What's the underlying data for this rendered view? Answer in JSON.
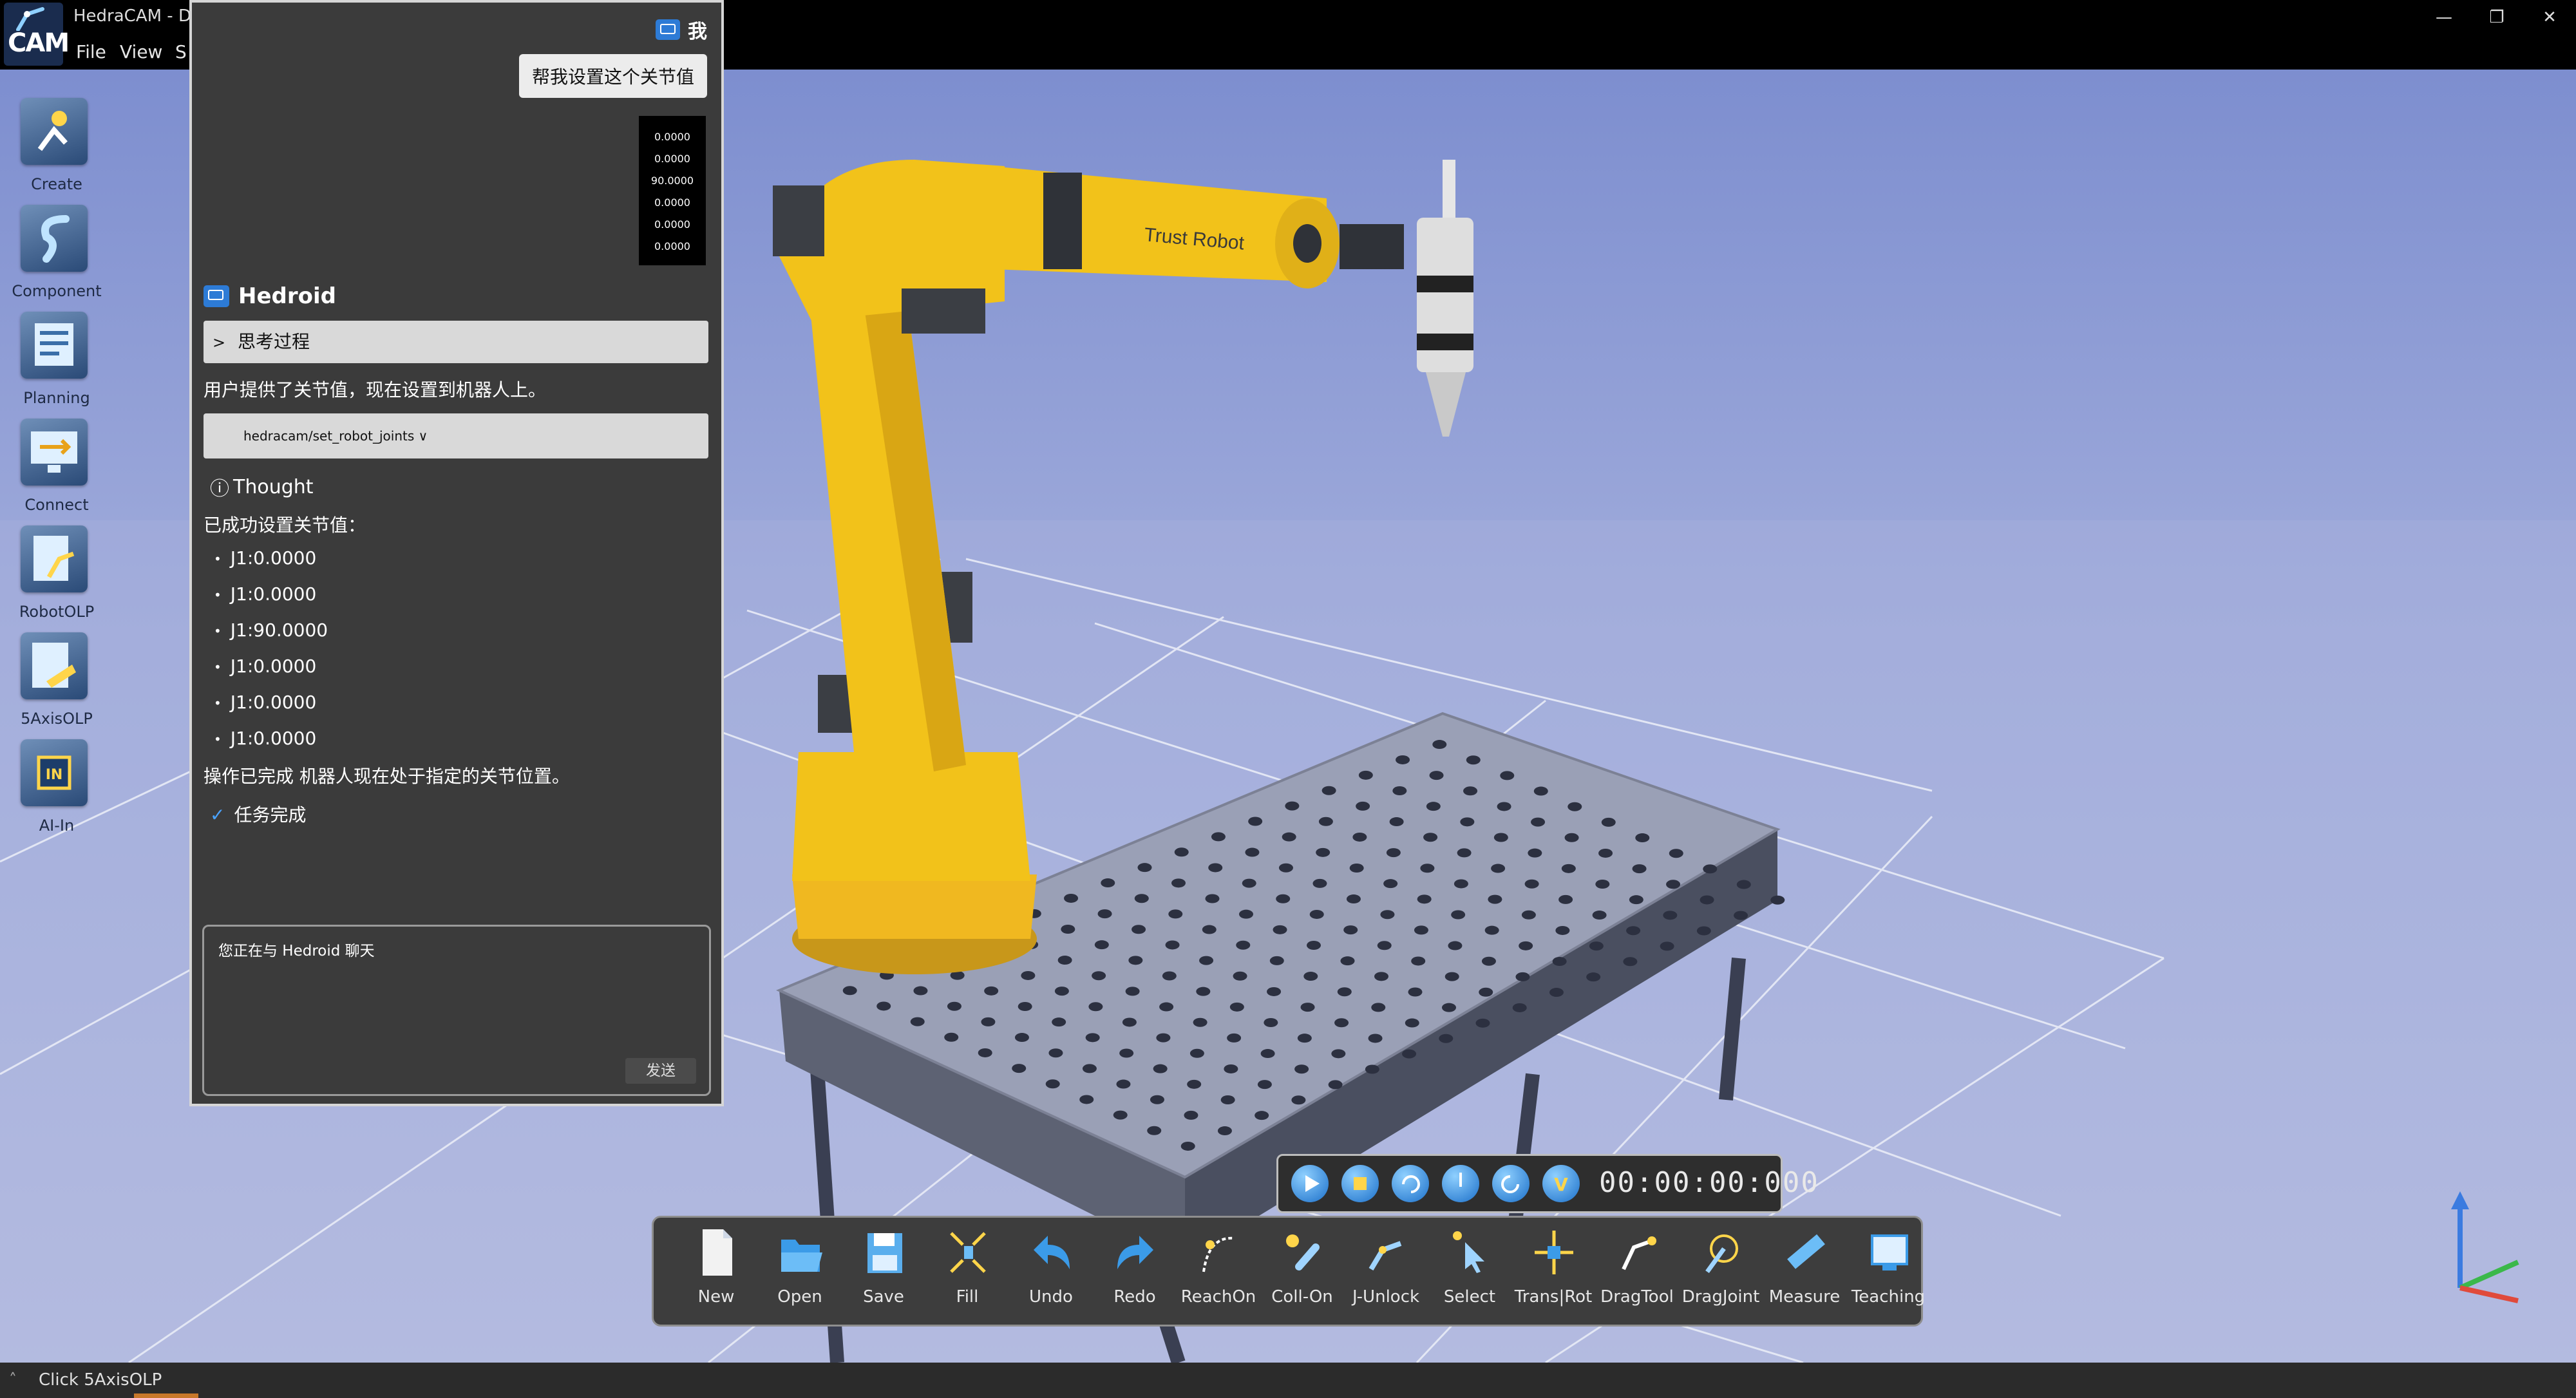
{
  "window": {
    "logo_text": "CAM",
    "title": "HedraCAM - D",
    "controls": [
      "—",
      "❐",
      "✕"
    ]
  },
  "menu": [
    "File",
    "View",
    "S"
  ],
  "left_toolbar": [
    {
      "label": "Create",
      "icon": "create-icon"
    },
    {
      "label": "Component",
      "icon": "component-icon"
    },
    {
      "label": "Planning",
      "icon": "planning-icon"
    },
    {
      "label": "Connect",
      "icon": "connect-icon"
    },
    {
      "label": "RobotOLP",
      "icon": "robot-olp-icon"
    },
    {
      "label": "5AxisOLP",
      "icon": "five-axis-olp-icon"
    },
    {
      "label": "AI-In",
      "icon": "ai-in-icon"
    }
  ],
  "chat": {
    "user_name": "我",
    "user_message": "帮我设置这个关节值",
    "joint_values": [
      "0.0000",
      "0.0000",
      "90.0000",
      "0.0000",
      "0.0000",
      "0.0000"
    ],
    "bot_name": "Hedroid",
    "thinking_label": "思考过程",
    "intro_text": "用户提供了关节值，现在设置到机器人上。",
    "tool_call": "hedracam/set_robot_joints ∨",
    "thought_label": "Thought",
    "success_text": "已成功设置关节值：",
    "joint_results": [
      "J1:0.0000",
      "J1:0.0000",
      "J1:90.0000",
      "J1:0.0000",
      "J1:0.0000",
      "J1:0.0000"
    ],
    "complete_text": "操作已完成 机器人现在处于指定的关节位置。",
    "task_done": "任务完成",
    "input_placeholder": "您正在与 Hedroid 聊天",
    "send_label": "发送"
  },
  "scene": {
    "robot_label": "Trust Robot"
  },
  "playback": {
    "time": "00:00:00:000",
    "buttons": [
      "play-icon",
      "stop-icon",
      "loop-icon",
      "speed-icon",
      "reverse-icon",
      "v-icon"
    ]
  },
  "bottom_toolbar": [
    "New",
    "Open",
    "Save",
    "Fill",
    "Undo",
    "Redo",
    "ReachOn",
    "Coll-On",
    "J-Unlock",
    "Select",
    "Trans|Rot",
    "DragTool",
    "DragJoint",
    "Measure",
    "Teaching"
  ],
  "status": {
    "text": "Click 5AxisOLP"
  },
  "colors": {
    "robot_yellow": "#f2c21a",
    "panel_bg": "#3b3b3b",
    "accent_blue": "#2d7bd6",
    "sky": "#8f9fd6"
  }
}
